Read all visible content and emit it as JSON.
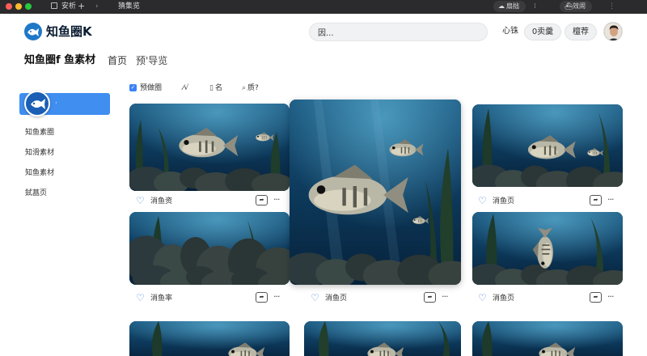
{
  "window": {
    "tab_title": "安析",
    "tab_plus": "+",
    "tab2_title": "猜集览",
    "pill1_label": "扇拙",
    "pill2_label": "效闹"
  },
  "header": {
    "logo_text": "知鱼圈K",
    "search_value": "因...",
    "link1": "心铢",
    "btn1_label": "0卖羹",
    "btn2_label": "檀荐"
  },
  "breadcrumb": {
    "site": "知鱼圈f 鱼素材",
    "home": "首页",
    "current": "预'导览"
  },
  "sidebar": {
    "active_label": "·",
    "items": [
      {
        "label": "知鱼素圈"
      },
      {
        "label": "知滑素材"
      },
      {
        "label": "知鱼素材"
      },
      {
        "label": "鉽蕌页"
      }
    ]
  },
  "toolbar": {
    "filter": "预做圈",
    "sort_glyph": "⁄√",
    "name": "名",
    "search": "质?"
  },
  "cards": [
    {
      "name": "消鱼资",
      "more": "···"
    },
    {
      "name": "消鱼页",
      "more": "···"
    },
    {
      "name": "消鱼率",
      "more": "···"
    },
    {
      "name": "消鱼页",
      "more": "···"
    },
    {
      "name": "消鱼页",
      "more": "···"
    }
  ],
  "colors": {
    "accent": "#3f8ef0",
    "titlebar": "#2b2b2d",
    "heart": "#4a86d6"
  }
}
